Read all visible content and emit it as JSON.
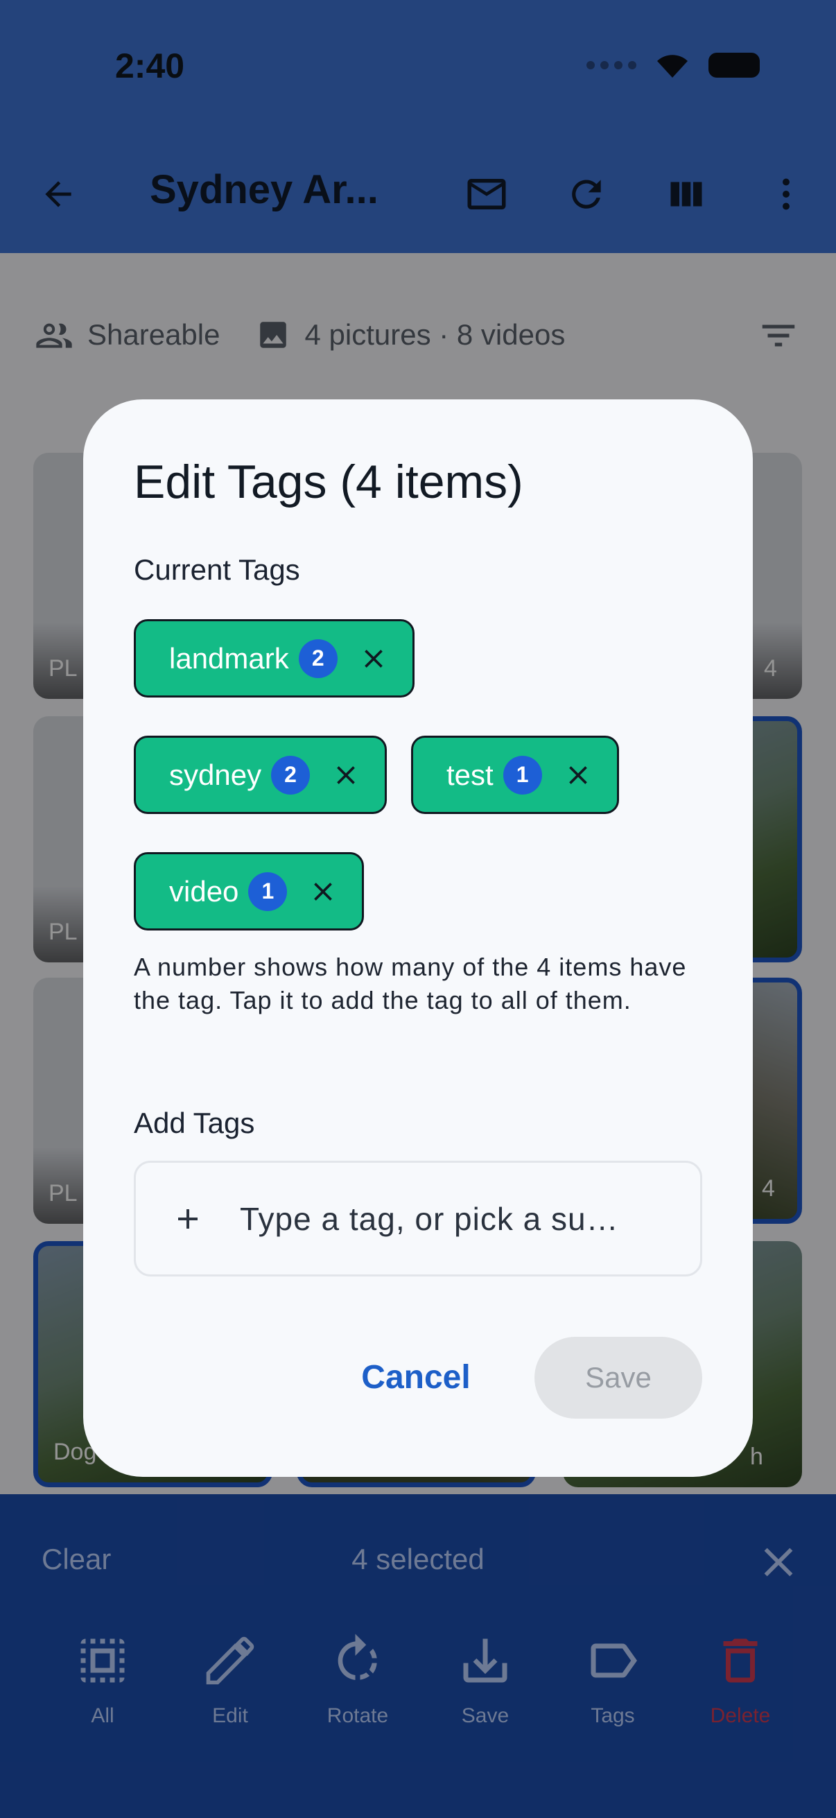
{
  "status": {
    "time": "2:40"
  },
  "app_bar": {
    "title": "Sydney Ar..."
  },
  "info": {
    "shareable": "Shareable",
    "media_count": "4 pictures · 8 videos"
  },
  "thumbnails": {
    "r1_left": "PL",
    "r2_left": "PL",
    "r3_left": "PL",
    "r4_left": "Dog",
    "r1_right": "4",
    "r3_right": "4",
    "r4_right": "h"
  },
  "dialog": {
    "title": "Edit Tags (4 items)",
    "current_tags_label": "Current Tags",
    "tags": [
      {
        "label": "landmark",
        "count": "2"
      },
      {
        "label": "sydney",
        "count": "2"
      },
      {
        "label": "test",
        "count": "1"
      },
      {
        "label": "video",
        "count": "1"
      }
    ],
    "help_text": "A number shows how many of the 4 items have the tag. Tap it to add the tag to all of them.",
    "add_tags_label": "Add Tags",
    "input_placeholder": "Type a tag, or pick a su…",
    "cancel_label": "Cancel",
    "save_label": "Save"
  },
  "selection_bar": {
    "clear_label": "Clear",
    "count_label": "4 selected",
    "actions": [
      {
        "label": "All",
        "icon": "select-all-icon"
      },
      {
        "label": "Edit",
        "icon": "pencil-icon"
      },
      {
        "label": "Rotate",
        "icon": "rotate-icon"
      },
      {
        "label": "Save",
        "icon": "download-icon"
      },
      {
        "label": "Tags",
        "icon": "tag-icon"
      },
      {
        "label": "Delete",
        "icon": "trash-icon"
      }
    ]
  },
  "colors": {
    "accent": "#1d5fc8",
    "chip": "#13bb86",
    "count_badge": "#1d5fd6",
    "app_bar": "#3e74d4"
  }
}
